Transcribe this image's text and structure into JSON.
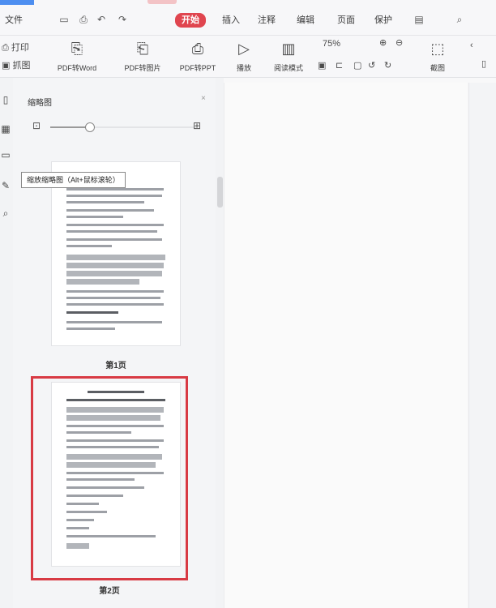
{
  "menubar": {
    "file_label": "文件",
    "start_label": "开始",
    "insert_label": "插入",
    "tabs": [
      "注释",
      "编辑",
      "页面",
      "保护"
    ],
    "quick_icons": [
      "save-icon",
      "print-icon",
      "undo-icon",
      "redo-icon"
    ]
  },
  "ribbon": {
    "left_labels": [
      "打印",
      "抓图"
    ],
    "buttons": [
      "PDF转Word",
      "PDF转图片",
      "PDF转PPT",
      "播放",
      "阅读模式",
      "旋转",
      "查找"
    ],
    "zoom_text": "75%",
    "last_label": "截图"
  },
  "navpane": {
    "title": "缩略图",
    "tooltip": "缩放缩略图（Alt+鼠标滚轮）",
    "zoom_level": 0.27,
    "pages": [
      {
        "label": "第1页",
        "selected": false
      },
      {
        "label": "第2页",
        "selected": true
      }
    ]
  },
  "colors": {
    "accent": "#e0454f",
    "selection": "#d83a44",
    "brand_blue": "#4d8ef0"
  }
}
